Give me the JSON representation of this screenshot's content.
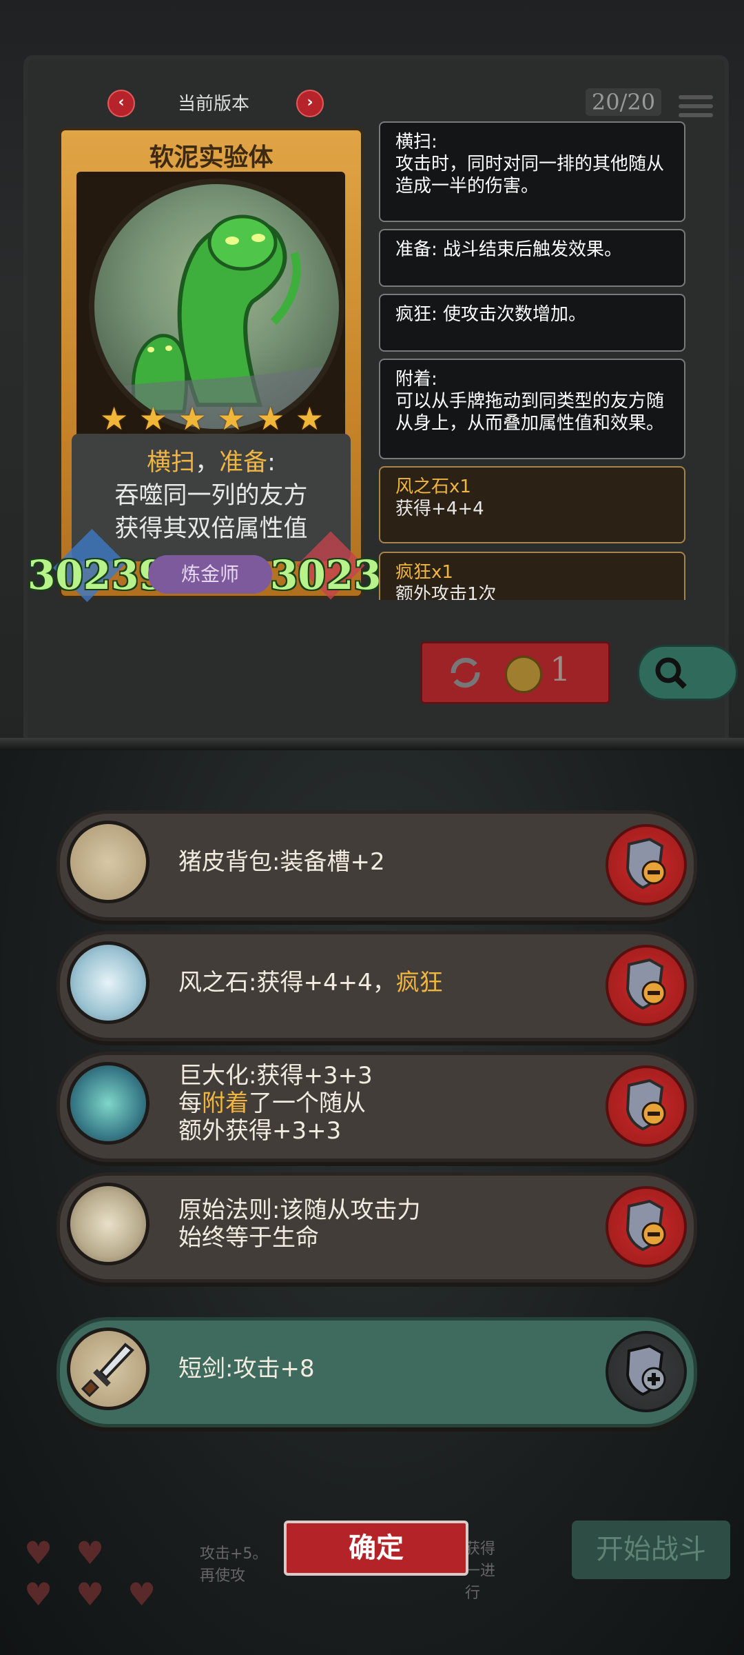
{
  "header": {
    "version_label": "当前版本",
    "prev_arrow": "‹",
    "next_arrow": "›",
    "counter": "20/20"
  },
  "card": {
    "title": "软泥实验体",
    "stars": 6,
    "desc_keyword1": "横扫",
    "desc_sep": "，",
    "desc_keyword2": "准备",
    "desc_colon": ":",
    "desc_line2": "吞噬同一列的友方",
    "desc_line3": "获得其双倍属性值",
    "attack": "30239",
    "health": "30239",
    "class_badge": "炼金师"
  },
  "keywords": [
    {
      "title": "横扫:",
      "body": "攻击时，同时对同一排的其他随从造成一半的伤害。"
    },
    {
      "title": "准备:",
      "body": "战斗结束后触发效果。"
    },
    {
      "title": "疯狂:",
      "body": "使攻击次数增加。"
    },
    {
      "title": "附着:",
      "body": "可以从手牌拖动到同类型的友方随从身上，从而叠加属性值和效果。"
    },
    {
      "title": "风之石x1",
      "body": "获得+4+4"
    },
    {
      "title": "疯狂x1",
      "body": "额外攻击1次"
    }
  ],
  "controls": {
    "refresh_cost": "1"
  },
  "items": [
    {
      "line1_pre": "猪皮背包:装备槽+2",
      "line1_kw": "",
      "line2_pre": "",
      "line2_kw": "",
      "line2_post": "",
      "line3": ""
    },
    {
      "line1_pre": "风之石:获得+4+4，",
      "line1_kw": "疯狂",
      "line2_pre": "",
      "line2_kw": "",
      "line2_post": "",
      "line3": ""
    },
    {
      "line1_pre": "巨大化:获得+3+3",
      "line1_kw": "",
      "line2_pre": "每",
      "line2_kw": "附着",
      "line2_post": "了一个随从",
      "line3": "额外获得+3+3"
    },
    {
      "line1_pre": "原始法则:该随从攻击力",
      "line1_kw": "",
      "line2_pre": "始终等于生命",
      "line2_kw": "",
      "line2_post": "",
      "line3": ""
    },
    {
      "line1_pre": "短剑:攻击+8",
      "line1_kw": "",
      "line2_pre": "",
      "line2_kw": "",
      "line2_post": "",
      "line3": ""
    }
  ],
  "bottom": {
    "confirm": "确定",
    "start_battle": "开始战斗",
    "faded_left": "攻击+5。再使攻",
    "faded_mid": "获得一进行"
  },
  "colors": {
    "keyword": "#f0b640",
    "stat_green": "#b7f28a",
    "remove_red": "#c92a2a",
    "row_green": "#3f6a5e"
  }
}
